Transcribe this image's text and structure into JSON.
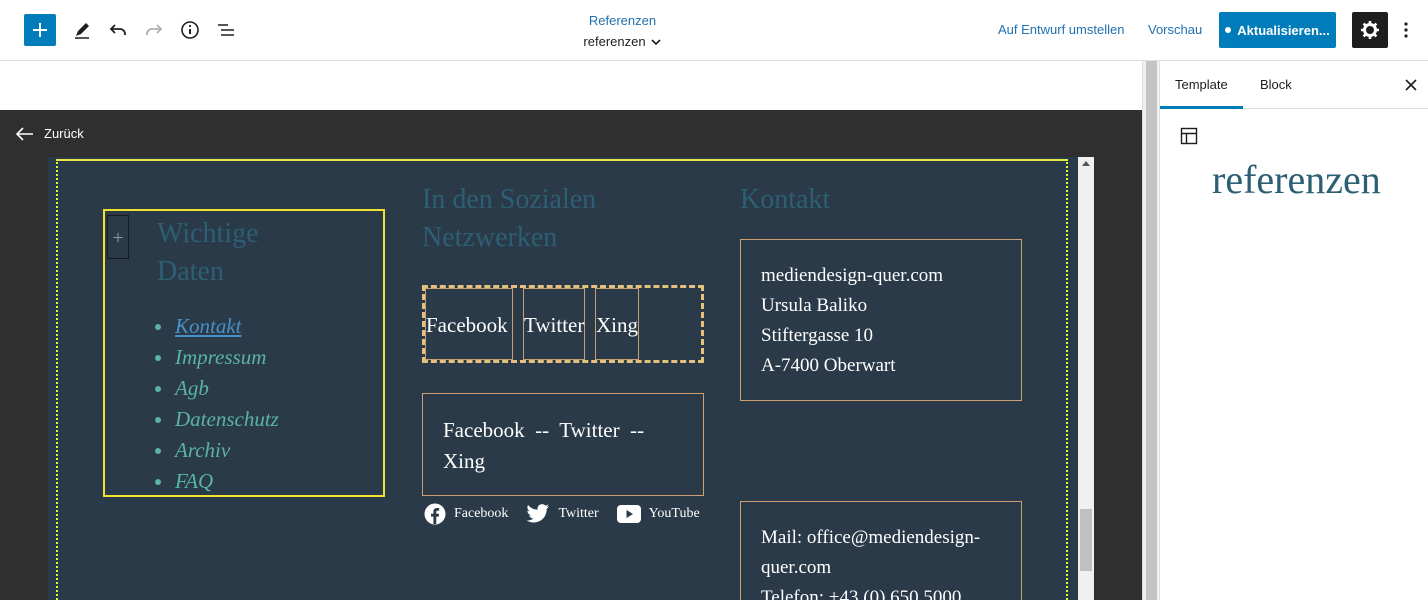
{
  "header": {
    "doc_title": "Referenzen",
    "doc_subtitle": "referenzen",
    "switch_draft": "Auf Entwurf umstellen",
    "preview": "Vorschau",
    "update": "Aktualisieren..."
  },
  "canvas": {
    "back_label": "Zurück"
  },
  "footer": {
    "col1_heading_line1": "Wichtige",
    "col1_heading_line2": "Daten",
    "nav_items": [
      "Kontakt",
      "Impressum",
      "Agb",
      "Datenschutz",
      "Archiv",
      "FAQ"
    ],
    "col2_heading_line1": "In den Sozialen",
    "col2_heading_line2": "Netzwerken",
    "social_buttons": [
      "Facebook",
      "Twitter",
      "Xing"
    ],
    "social_text_line1": "Facebook  --  Twitter  --",
    "social_text_line2": "Xing",
    "social_icons": [
      "Facebook",
      "Twitter",
      "YouTube"
    ],
    "col3_heading": "Kontakt",
    "address": [
      "mediendesign-quer.com",
      "Ursula Baliko",
      "Stiftergasse 10",
      "A-7400 Oberwart"
    ],
    "contact": [
      "Mail: office@mediendesign-",
      "quer.com",
      "Telefon: +43 (0) 650 5000"
    ]
  },
  "sidebar": {
    "tab_template": "Template",
    "tab_block": "Block",
    "template_name": "referenzen"
  },
  "colors": {
    "accent": "#007cba",
    "footer_bg": "#2a3a48",
    "heading": "#2d5f74",
    "nav": "#5ab4a3",
    "selection": "#f2e230"
  }
}
